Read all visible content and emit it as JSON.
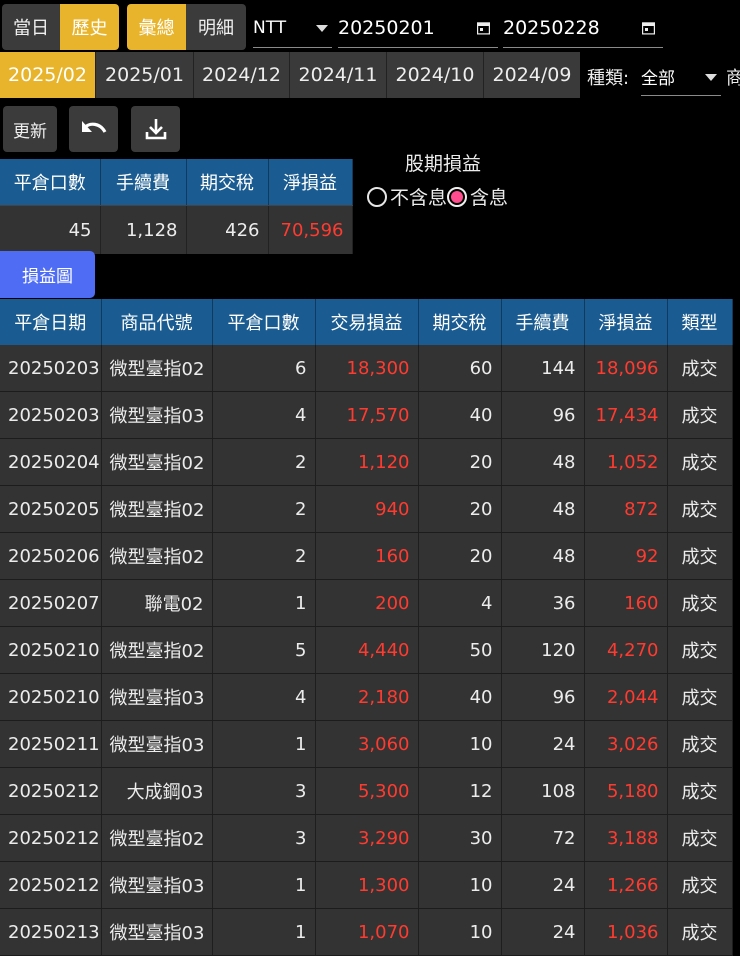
{
  "mode_tabs": {
    "today": "當日",
    "history": "歷史"
  },
  "view_tabs": {
    "summary": "彙總",
    "detail": "明細"
  },
  "currency": {
    "value": "NTT"
  },
  "date_range": {
    "start": "20250201",
    "end": "20250228"
  },
  "month_tabs": [
    "2025/02",
    "2025/01",
    "2024/12",
    "2024/11",
    "2024/10",
    "2024/09"
  ],
  "category": {
    "label": "種類:",
    "value": "全部",
    "next_label": "商"
  },
  "toolbar": {
    "refresh": "更新"
  },
  "summary": {
    "headers": [
      "平倉口數",
      "手續費",
      "期交稅",
      "淨損益"
    ],
    "values": [
      "45",
      "1,128",
      "426",
      "70,596"
    ]
  },
  "dividend": {
    "title": "股期損益",
    "exclude": "不含息",
    "include": "含息",
    "selected": "include"
  },
  "chart_button": "損益圖",
  "colors": {
    "accent_gold": "#e8b42c",
    "header_blue": "#1a5c91",
    "profit_red": "#ff3b30",
    "chart_button": "#4f6cf5"
  },
  "table": {
    "headers": [
      "平倉日期",
      "商品代號",
      "平倉口數",
      "交易損益",
      "期交稅",
      "手續費",
      "淨損益",
      "類型"
    ],
    "rows": [
      [
        "20250203",
        "微型臺指02",
        "6",
        "18,300",
        "60",
        "144",
        "18,096",
        "成交"
      ],
      [
        "20250203",
        "微型臺指03",
        "4",
        "17,570",
        "40",
        "96",
        "17,434",
        "成交"
      ],
      [
        "20250204",
        "微型臺指02",
        "2",
        "1,120",
        "20",
        "48",
        "1,052",
        "成交"
      ],
      [
        "20250205",
        "微型臺指02",
        "2",
        "940",
        "20",
        "48",
        "872",
        "成交"
      ],
      [
        "20250206",
        "微型臺指02",
        "2",
        "160",
        "20",
        "48",
        "92",
        "成交"
      ],
      [
        "20250207",
        "聯電02",
        "1",
        "200",
        "4",
        "36",
        "160",
        "成交"
      ],
      [
        "20250210",
        "微型臺指02",
        "5",
        "4,440",
        "50",
        "120",
        "4,270",
        "成交"
      ],
      [
        "20250210",
        "微型臺指03",
        "4",
        "2,180",
        "40",
        "96",
        "2,044",
        "成交"
      ],
      [
        "20250211",
        "微型臺指03",
        "1",
        "3,060",
        "10",
        "24",
        "3,026",
        "成交"
      ],
      [
        "20250212",
        "大成鋼03",
        "3",
        "5,300",
        "12",
        "108",
        "5,180",
        "成交"
      ],
      [
        "20250212",
        "微型臺指02",
        "3",
        "3,290",
        "30",
        "72",
        "3,188",
        "成交"
      ],
      [
        "20250212",
        "微型臺指03",
        "1",
        "1,300",
        "10",
        "24",
        "1,266",
        "成交"
      ],
      [
        "20250213",
        "微型臺指03",
        "1",
        "1,070",
        "10",
        "24",
        "1,036",
        "成交"
      ]
    ]
  }
}
